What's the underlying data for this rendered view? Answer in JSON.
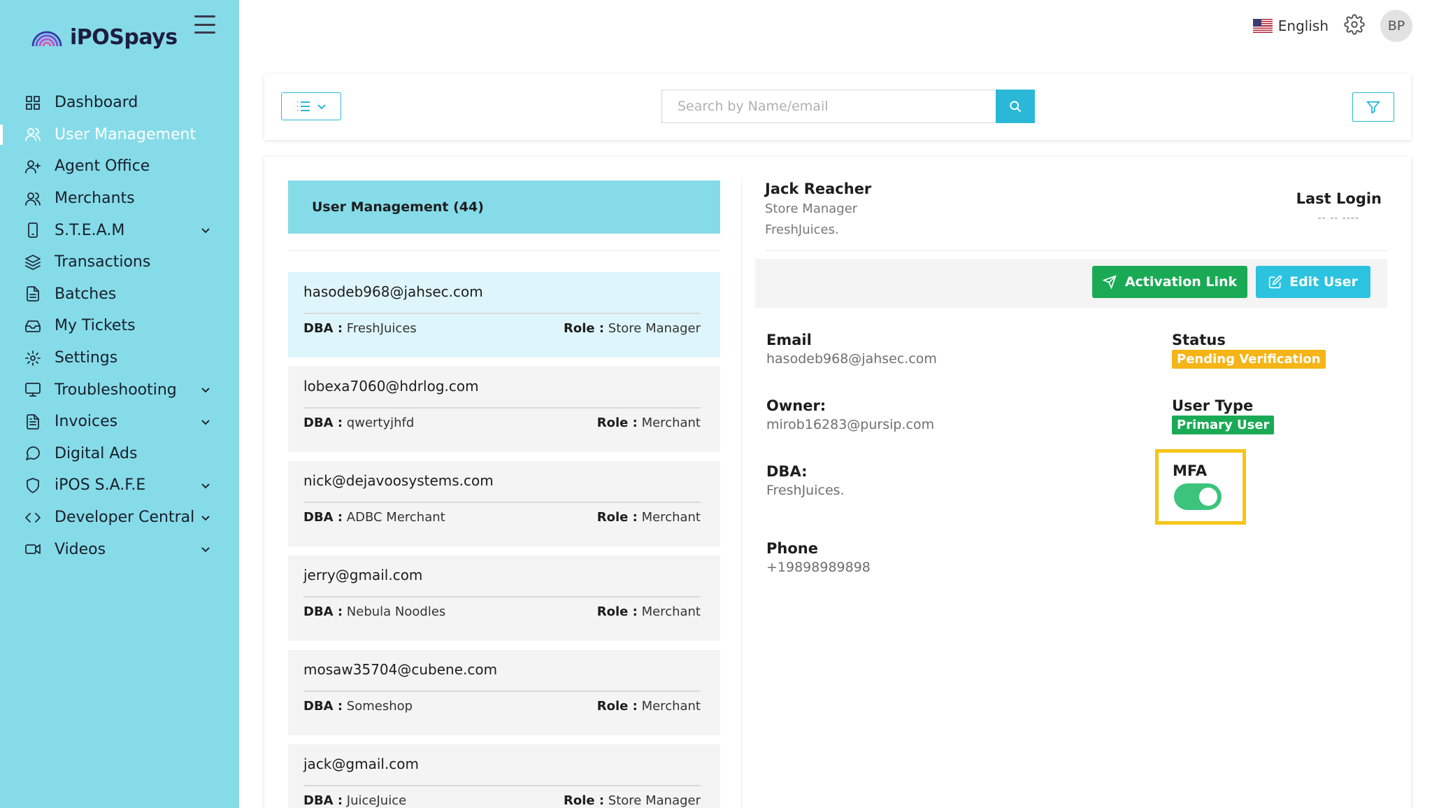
{
  "brand": {
    "name": "iPOSpays"
  },
  "sidebar": {
    "items": [
      {
        "label": "Dashboard",
        "icon": "dashboard-icon",
        "active": false,
        "expandable": false
      },
      {
        "label": "User Management",
        "icon": "users-icon",
        "active": true,
        "expandable": false
      },
      {
        "label": "Agent Office",
        "icon": "user-plus-icon",
        "active": false,
        "expandable": false
      },
      {
        "label": "Merchants",
        "icon": "merchants-icon",
        "active": false,
        "expandable": false
      },
      {
        "label": "S.T.E.A.M",
        "icon": "device-icon",
        "active": false,
        "expandable": true
      },
      {
        "label": "Transactions",
        "icon": "layers-icon",
        "active": false,
        "expandable": false
      },
      {
        "label": "Batches",
        "icon": "document-icon",
        "active": false,
        "expandable": false
      },
      {
        "label": "My Tickets",
        "icon": "inbox-icon",
        "active": false,
        "expandable": false
      },
      {
        "label": "Settings",
        "icon": "gear-icon",
        "active": false,
        "expandable": false
      },
      {
        "label": "Troubleshooting",
        "icon": "monitor-icon",
        "active": false,
        "expandable": true
      },
      {
        "label": "Invoices",
        "icon": "invoice-icon",
        "active": false,
        "expandable": true
      },
      {
        "label": "Digital Ads",
        "icon": "chat-bubble-icon",
        "active": false,
        "expandable": false
      },
      {
        "label": "iPOS S.A.F.E",
        "icon": "shield-icon",
        "active": false,
        "expandable": true
      },
      {
        "label": "Developer Central",
        "icon": "code-icon",
        "active": false,
        "expandable": true
      },
      {
        "label": "Videos",
        "icon": "video-icon",
        "active": false,
        "expandable": true
      }
    ]
  },
  "topbar": {
    "language": "English",
    "avatar_initials": "BP"
  },
  "toolbar": {
    "search_placeholder": "Search by Name/email"
  },
  "list": {
    "header": "User Management (44)",
    "dba_label": "DBA :",
    "role_label": "Role :",
    "users": [
      {
        "email": "hasodeb968@jahsec.com",
        "dba": "FreshJuices",
        "role": "Store Manager",
        "selected": true
      },
      {
        "email": "lobexa7060@hdrlog.com",
        "dba": "qwertyjhfd",
        "role": "Merchant",
        "selected": false
      },
      {
        "email": "nick@dejavoosystems.com",
        "dba": "ADBC Merchant",
        "role": "Merchant",
        "selected": false
      },
      {
        "email": "jerry@gmail.com",
        "dba": "Nebula Noodles",
        "role": "Merchant",
        "selected": false
      },
      {
        "email": "mosaw35704@cubene.com",
        "dba": "Someshop",
        "role": "Merchant",
        "selected": false
      },
      {
        "email": "jack@gmail.com",
        "dba": "JuiceJuice",
        "role": "Store Manager",
        "selected": false
      }
    ]
  },
  "detail": {
    "name": "Jack Reacher",
    "title": "Store Manager",
    "company": "FreshJuices.",
    "last_login_label": "Last Login",
    "last_login_value": "-- -- ----",
    "activation_button": "Activation Link",
    "edit_button": "Edit User",
    "email_label": "Email",
    "email_value": "hasodeb968@jahsec.com",
    "owner_label": "Owner:",
    "owner_value": "mirob16283@pursip.com",
    "dba_label": "DBA:",
    "dba_value": "FreshJuices.",
    "phone_label": "Phone",
    "phone_value": "+19898989898",
    "status_label": "Status",
    "status_value": "Pending Verification",
    "user_type_label": "User Type",
    "user_type_value": "Primary User",
    "mfa_label": "MFA",
    "mfa_enabled": true
  },
  "colors": {
    "sidebar_bg": "#86dbe9",
    "accent": "#2bb8d6",
    "success": "#1aaa55",
    "warning": "#f5b418",
    "highlight": "#f5c518"
  }
}
